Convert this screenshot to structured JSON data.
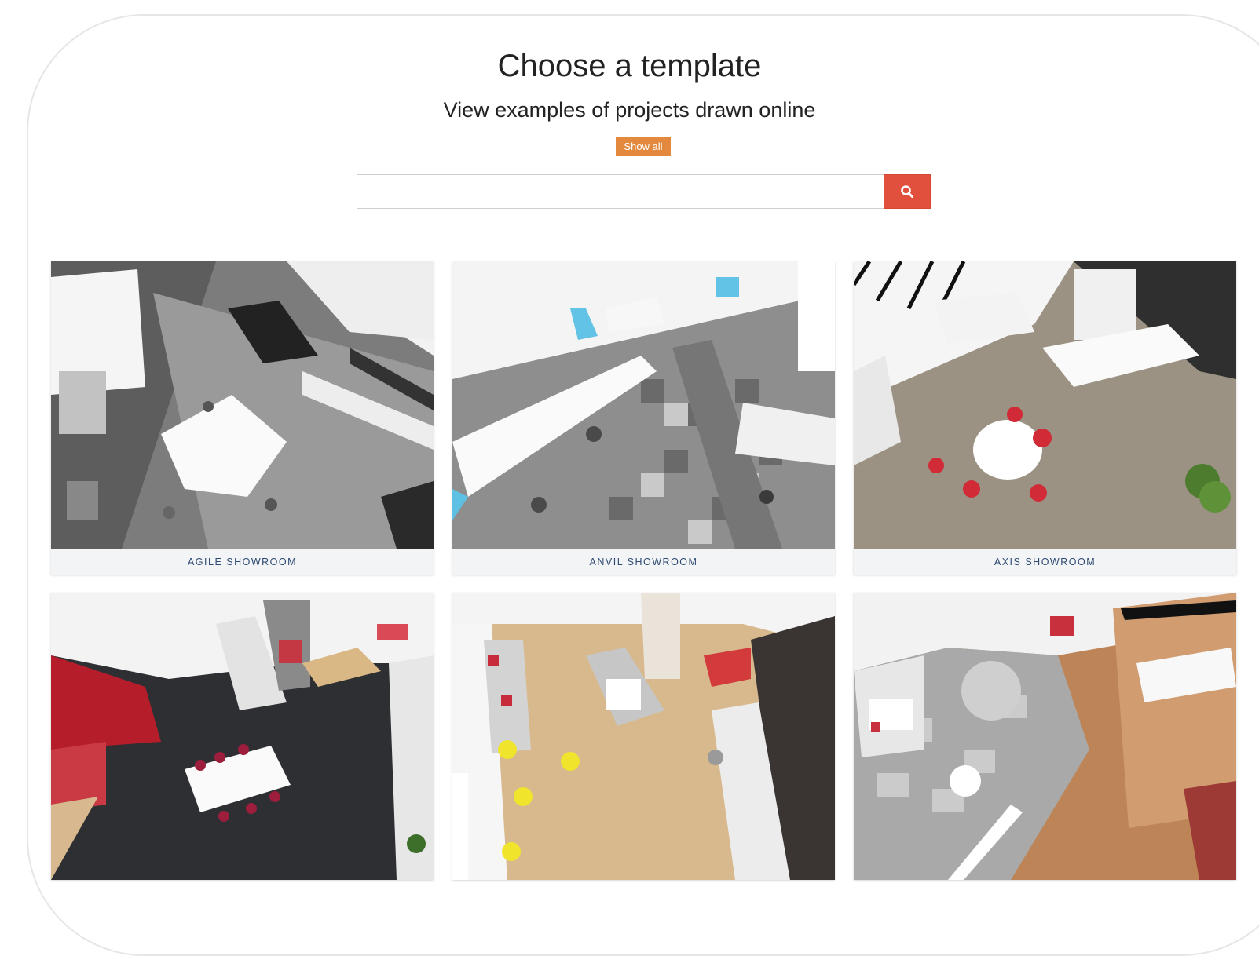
{
  "header": {
    "title": "Choose a template",
    "subtitle": "View examples of projects drawn online",
    "show_all_label": "Show all"
  },
  "search": {
    "value": "",
    "placeholder": "",
    "icon": "search-icon",
    "button_color": "#e0503c"
  },
  "accent_colors": {
    "show_all": "#e3893d",
    "caption_text": "#2e4a73"
  },
  "templates": [
    {
      "label": "AGILE SHOWROOM"
    },
    {
      "label": "ANVIL SHOWROOM"
    },
    {
      "label": "AXIS SHOWROOM"
    },
    {
      "label": ""
    },
    {
      "label": ""
    },
    {
      "label": ""
    }
  ]
}
